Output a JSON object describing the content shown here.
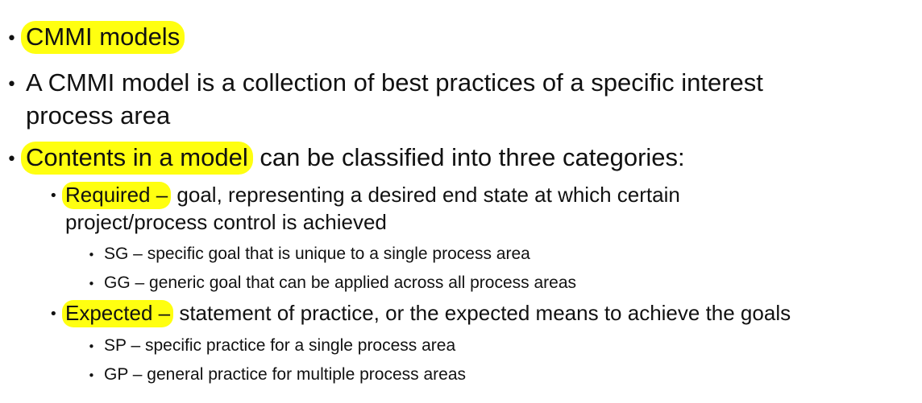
{
  "bullets": {
    "b1": {
      "highlight": "CMMI models",
      "rest": ""
    },
    "b2": {
      "line1": "A CMMI model is a collection of best practices of a specific interest",
      "line2": "process area"
    },
    "b3": {
      "highlight": "Contents in a model",
      "rest": " can be classified into three categories:"
    },
    "required": {
      "highlight": "Required –",
      "rest": " goal, representing a desired end state at which certain",
      "line2": "project/process control is achieved",
      "sub": [
        "SG – specific goal that is unique to a single process area",
        "GG – generic goal that can be applied across all process areas"
      ]
    },
    "expected": {
      "highlight": "Expected –",
      "rest": " statement of practice, or the expected means to achieve the goals",
      "sub": [
        "SP – specific practice for a single process area",
        "GP – general practice for multiple process areas"
      ]
    }
  },
  "colors": {
    "highlight": "#ffff10",
    "text": "#111111"
  }
}
